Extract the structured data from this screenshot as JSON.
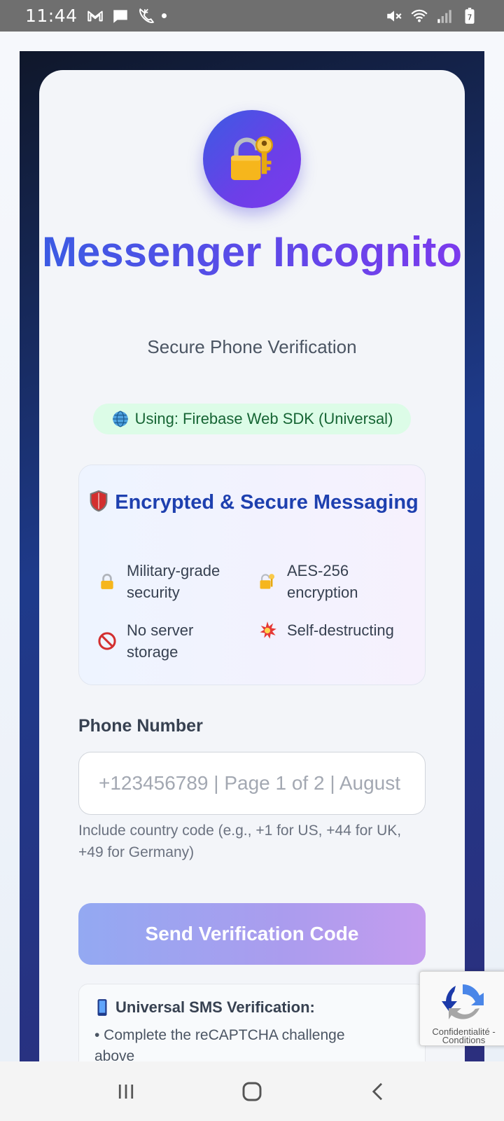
{
  "status_bar": {
    "time": "11:44",
    "left_icons": [
      "gmail-icon",
      "message-icon",
      "call-icon",
      "dot-icon"
    ],
    "right_icons": [
      "mute-icon",
      "wifi-icon",
      "signal-icon",
      "battery-icon"
    ],
    "battery_level": "7"
  },
  "header": {
    "title": "Messenger Incognito",
    "subtitle": "Secure Phone Verification",
    "sdk_badge": "Using: Firebase Web SDK (Universal)"
  },
  "features": {
    "title": "Encrypted & Secure Messaging",
    "items": [
      {
        "icon": "lock-icon",
        "label": "Military-grade security"
      },
      {
        "icon": "lock-key-icon",
        "label": "AES-256 encryption"
      },
      {
        "icon": "no-entry-icon",
        "label": "No server storage"
      },
      {
        "icon": "explosion-icon",
        "label": "Self-destructing"
      }
    ]
  },
  "phone": {
    "label": "Phone Number",
    "placeholder": "+123456789 | Page 1 of 2 | August",
    "help": "Include country code (e.g., +1 for US, +44 for UK, +49 for Germany)"
  },
  "send_button": {
    "label": "Send Verification Code"
  },
  "info": {
    "title": "Universal SMS Verification:",
    "line1": "• Complete the reCAPTCHA challenge above"
  },
  "recaptcha": {
    "text": "Confidentialité - Conditions"
  },
  "colors": {
    "accent_start": "#3b5be3",
    "accent_end": "#7c3aed",
    "badge_bg": "#dcfce7",
    "badge_text": "#166534",
    "features_title": "#1e40af"
  }
}
